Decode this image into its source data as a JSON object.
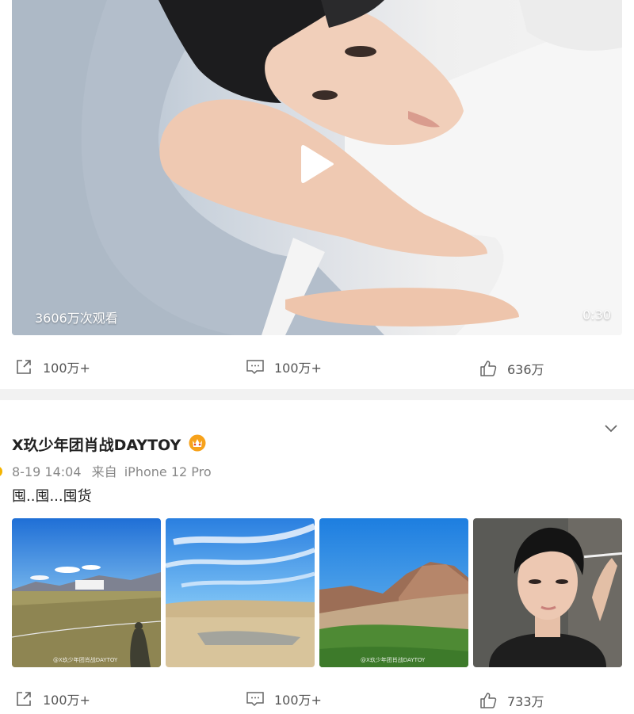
{
  "post1": {
    "video": {
      "views": "3606万次观看",
      "duration": "0:30",
      "play_icon": "play-icon"
    },
    "actions": {
      "share": "100万+",
      "comment": "100万+",
      "like": "636万"
    }
  },
  "post2": {
    "author": "X玖少年团肖战DAYTOY",
    "badge_icon": "crown-icon",
    "time": "8-19 14:04",
    "source_prefix": "来自",
    "source": "iPhone 12 Pro",
    "text": "囤..囤...囤货",
    "images": [
      {
        "alt": "grassland-photo",
        "watermark": "@X玖少年团肖战DAYTOY"
      },
      {
        "alt": "desert-sky-photo",
        "watermark": ""
      },
      {
        "alt": "rocky-hills-photo",
        "watermark": "@X玖少年团肖战DAYTOY"
      },
      {
        "alt": "selfie-photo",
        "watermark": ""
      }
    ],
    "actions": {
      "share": "100万+",
      "comment": "100万+",
      "like": "733万"
    }
  },
  "colors": {
    "background": "#ffffff",
    "divider": "#f2f2f2",
    "crown": "#f7a21b",
    "meta_text": "#888888"
  }
}
